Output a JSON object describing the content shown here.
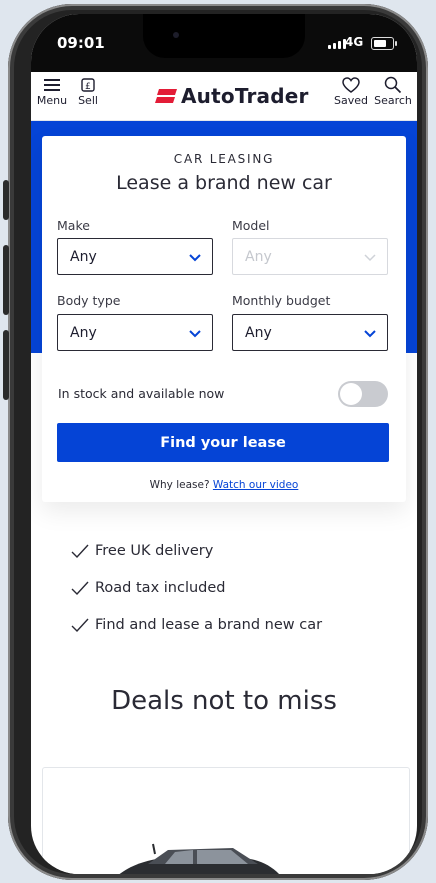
{
  "status_bar": {
    "time": "09:01",
    "network": "4G"
  },
  "nav": {
    "menu_label": "Menu",
    "sell_label": "Sell",
    "logo_text": "AutoTrader",
    "saved_label": "Saved",
    "search_label": "Search"
  },
  "search_card": {
    "kicker": "CAR LEASING",
    "headline": "Lease a brand new car",
    "make": {
      "label": "Make",
      "value": "Any"
    },
    "model": {
      "label": "Model",
      "value": "Any"
    },
    "body_type": {
      "label": "Body type",
      "value": "Any"
    },
    "monthly_budget": {
      "label": "Monthly budget",
      "value": "Any"
    },
    "in_stock_label": "In stock and available now",
    "in_stock_enabled": false,
    "cta_label": "Find your lease",
    "why_text": "Why lease?",
    "why_link": "Watch our video"
  },
  "benefits": [
    "Free UK delivery",
    "Road tax included",
    "Find and lease a brand new car"
  ],
  "deals": {
    "title": "Deals not to miss"
  },
  "colors": {
    "brand_blue": "#0544d6",
    "logo_red": "#e31c37",
    "text_dark": "#2a2a35"
  },
  "icons": {
    "menu": "hamburger-icon",
    "sell": "pound-tag-icon",
    "saved": "heart-icon",
    "search": "search-icon",
    "dropdown": "chevron-down-icon",
    "benefit": "check-icon"
  }
}
